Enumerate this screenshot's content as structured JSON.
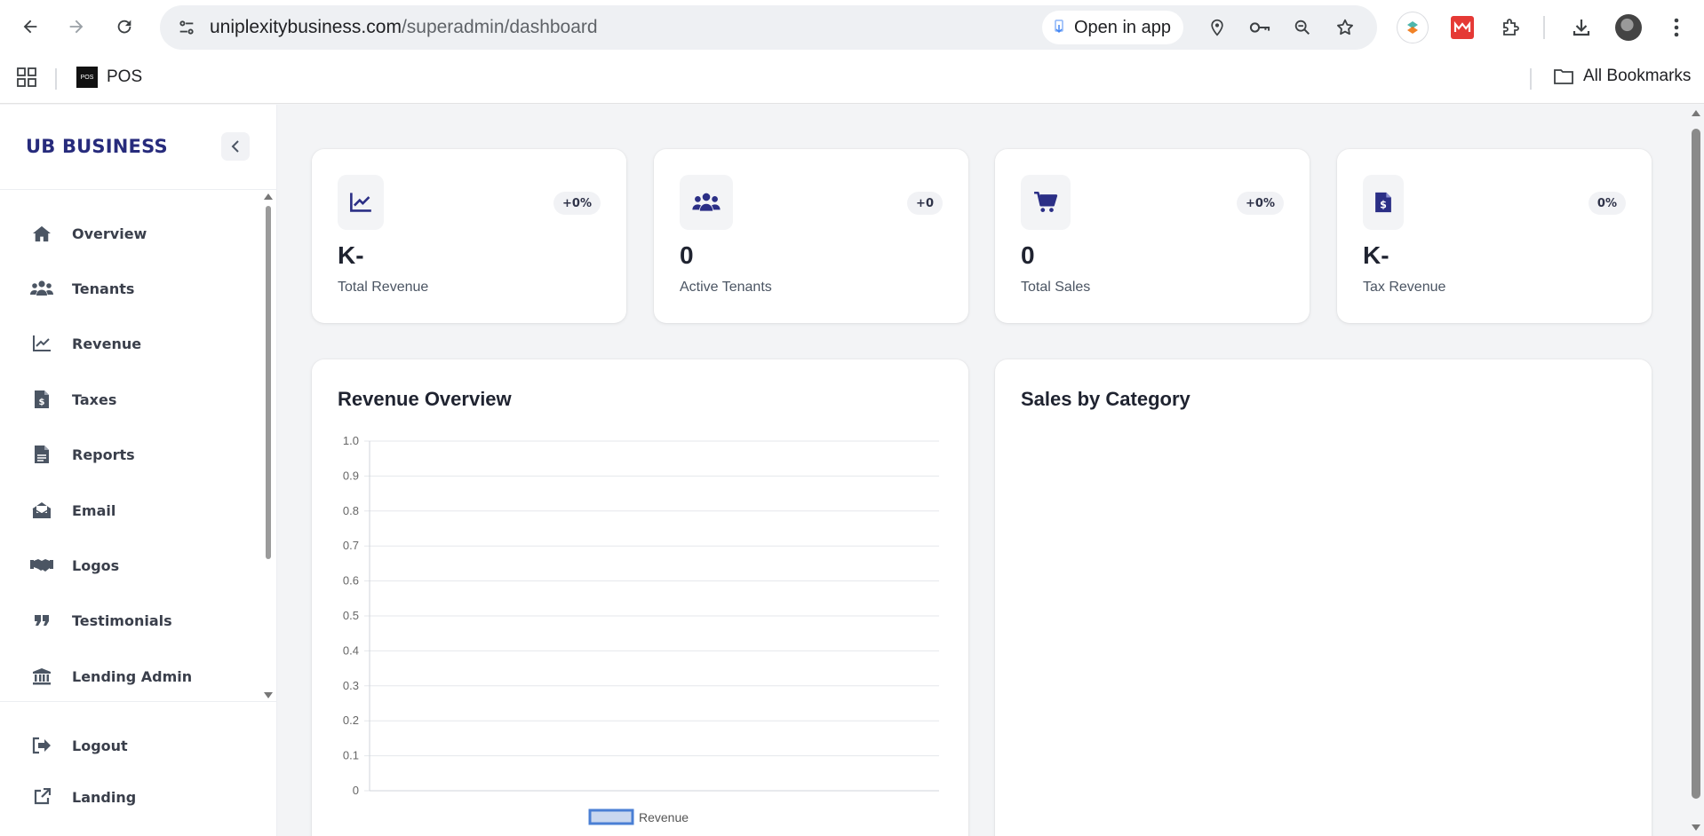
{
  "browser": {
    "url_host": "uniplexitybusiness.com",
    "url_path": "/superadmin/dashboard",
    "open_in_app_label": "Open in app",
    "bookmarks": [
      {
        "label": "POS",
        "favicon_text": "POS"
      }
    ],
    "all_bookmarks_label": "All Bookmarks"
  },
  "sidebar": {
    "brand": "UB BUSINESS",
    "items": [
      {
        "label": "Overview",
        "icon": "home-icon"
      },
      {
        "label": "Tenants",
        "icon": "users-icon"
      },
      {
        "label": "Revenue",
        "icon": "chart-line-icon"
      },
      {
        "label": "Taxes",
        "icon": "file-invoice-dollar-icon"
      },
      {
        "label": "Reports",
        "icon": "file-icon"
      },
      {
        "label": "Email",
        "icon": "envelope-open-icon"
      },
      {
        "label": "Logos",
        "icon": "handshake-icon"
      },
      {
        "label": "Testimonials",
        "icon": "quote-icon"
      },
      {
        "label": "Lending Admin",
        "icon": "bank-icon"
      }
    ],
    "bottom_items": [
      {
        "label": "Logout",
        "icon": "logout-icon"
      },
      {
        "label": "Landing",
        "icon": "external-link-icon"
      }
    ]
  },
  "stats": [
    {
      "value": "K-",
      "label": "Total Revenue",
      "badge": "+0%",
      "icon": "chart-line-icon"
    },
    {
      "value": "0",
      "label": "Active Tenants",
      "badge": "+0",
      "icon": "users-icon"
    },
    {
      "value": "0",
      "label": "Total Sales",
      "badge": "+0%",
      "icon": "cart-icon"
    },
    {
      "value": "K-",
      "label": "Tax Revenue",
      "badge": "0%",
      "icon": "file-invoice-dollar-icon"
    }
  ],
  "revenue_overview": {
    "title": "Revenue Overview"
  },
  "sales_by_category": {
    "title": "Sales by Category"
  },
  "colors": {
    "brand": "#272b7c",
    "accent_icon": "#2b2f86",
    "series": "#4a7fd4"
  },
  "chart_data": {
    "type": "bar",
    "title": "Revenue Overview",
    "categories": [],
    "series": [
      {
        "name": "Revenue",
        "values": []
      }
    ],
    "ylim": [
      0,
      1.0
    ],
    "yticks": [
      "1.0",
      "0.9",
      "0.8",
      "0.7",
      "0.6",
      "0.5",
      "0.4",
      "0.3",
      "0.2",
      "0.1",
      "0"
    ],
    "grid": true,
    "legend": "bottom"
  }
}
